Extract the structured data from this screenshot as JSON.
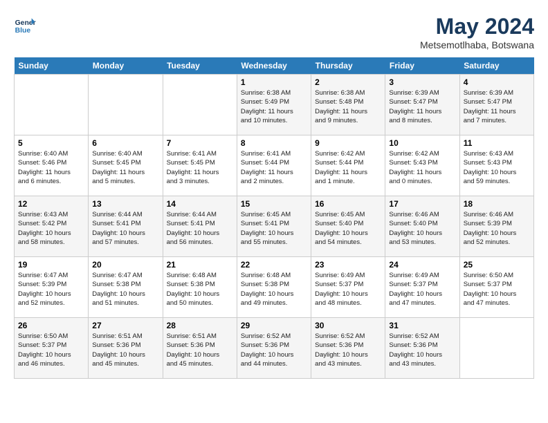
{
  "header": {
    "logo_line1": "General",
    "logo_line2": "Blue",
    "month": "May 2024",
    "location": "Metsemotlhaba, Botswana"
  },
  "days_of_week": [
    "Sunday",
    "Monday",
    "Tuesday",
    "Wednesday",
    "Thursday",
    "Friday",
    "Saturday"
  ],
  "weeks": [
    [
      {
        "num": "",
        "info": ""
      },
      {
        "num": "",
        "info": ""
      },
      {
        "num": "",
        "info": ""
      },
      {
        "num": "1",
        "info": "Sunrise: 6:38 AM\nSunset: 5:49 PM\nDaylight: 11 hours\nand 10 minutes."
      },
      {
        "num": "2",
        "info": "Sunrise: 6:38 AM\nSunset: 5:48 PM\nDaylight: 11 hours\nand 9 minutes."
      },
      {
        "num": "3",
        "info": "Sunrise: 6:39 AM\nSunset: 5:47 PM\nDaylight: 11 hours\nand 8 minutes."
      },
      {
        "num": "4",
        "info": "Sunrise: 6:39 AM\nSunset: 5:47 PM\nDaylight: 11 hours\nand 7 minutes."
      }
    ],
    [
      {
        "num": "5",
        "info": "Sunrise: 6:40 AM\nSunset: 5:46 PM\nDaylight: 11 hours\nand 6 minutes."
      },
      {
        "num": "6",
        "info": "Sunrise: 6:40 AM\nSunset: 5:45 PM\nDaylight: 11 hours\nand 5 minutes."
      },
      {
        "num": "7",
        "info": "Sunrise: 6:41 AM\nSunset: 5:45 PM\nDaylight: 11 hours\nand 3 minutes."
      },
      {
        "num": "8",
        "info": "Sunrise: 6:41 AM\nSunset: 5:44 PM\nDaylight: 11 hours\nand 2 minutes."
      },
      {
        "num": "9",
        "info": "Sunrise: 6:42 AM\nSunset: 5:44 PM\nDaylight: 11 hours\nand 1 minute."
      },
      {
        "num": "10",
        "info": "Sunrise: 6:42 AM\nSunset: 5:43 PM\nDaylight: 11 hours\nand 0 minutes."
      },
      {
        "num": "11",
        "info": "Sunrise: 6:43 AM\nSunset: 5:43 PM\nDaylight: 10 hours\nand 59 minutes."
      }
    ],
    [
      {
        "num": "12",
        "info": "Sunrise: 6:43 AM\nSunset: 5:42 PM\nDaylight: 10 hours\nand 58 minutes."
      },
      {
        "num": "13",
        "info": "Sunrise: 6:44 AM\nSunset: 5:41 PM\nDaylight: 10 hours\nand 57 minutes."
      },
      {
        "num": "14",
        "info": "Sunrise: 6:44 AM\nSunset: 5:41 PM\nDaylight: 10 hours\nand 56 minutes."
      },
      {
        "num": "15",
        "info": "Sunrise: 6:45 AM\nSunset: 5:41 PM\nDaylight: 10 hours\nand 55 minutes."
      },
      {
        "num": "16",
        "info": "Sunrise: 6:45 AM\nSunset: 5:40 PM\nDaylight: 10 hours\nand 54 minutes."
      },
      {
        "num": "17",
        "info": "Sunrise: 6:46 AM\nSunset: 5:40 PM\nDaylight: 10 hours\nand 53 minutes."
      },
      {
        "num": "18",
        "info": "Sunrise: 6:46 AM\nSunset: 5:39 PM\nDaylight: 10 hours\nand 52 minutes."
      }
    ],
    [
      {
        "num": "19",
        "info": "Sunrise: 6:47 AM\nSunset: 5:39 PM\nDaylight: 10 hours\nand 52 minutes."
      },
      {
        "num": "20",
        "info": "Sunrise: 6:47 AM\nSunset: 5:38 PM\nDaylight: 10 hours\nand 51 minutes."
      },
      {
        "num": "21",
        "info": "Sunrise: 6:48 AM\nSunset: 5:38 PM\nDaylight: 10 hours\nand 50 minutes."
      },
      {
        "num": "22",
        "info": "Sunrise: 6:48 AM\nSunset: 5:38 PM\nDaylight: 10 hours\nand 49 minutes."
      },
      {
        "num": "23",
        "info": "Sunrise: 6:49 AM\nSunset: 5:37 PM\nDaylight: 10 hours\nand 48 minutes."
      },
      {
        "num": "24",
        "info": "Sunrise: 6:49 AM\nSunset: 5:37 PM\nDaylight: 10 hours\nand 47 minutes."
      },
      {
        "num": "25",
        "info": "Sunrise: 6:50 AM\nSunset: 5:37 PM\nDaylight: 10 hours\nand 47 minutes."
      }
    ],
    [
      {
        "num": "26",
        "info": "Sunrise: 6:50 AM\nSunset: 5:37 PM\nDaylight: 10 hours\nand 46 minutes."
      },
      {
        "num": "27",
        "info": "Sunrise: 6:51 AM\nSunset: 5:36 PM\nDaylight: 10 hours\nand 45 minutes."
      },
      {
        "num": "28",
        "info": "Sunrise: 6:51 AM\nSunset: 5:36 PM\nDaylight: 10 hours\nand 45 minutes."
      },
      {
        "num": "29",
        "info": "Sunrise: 6:52 AM\nSunset: 5:36 PM\nDaylight: 10 hours\nand 44 minutes."
      },
      {
        "num": "30",
        "info": "Sunrise: 6:52 AM\nSunset: 5:36 PM\nDaylight: 10 hours\nand 43 minutes."
      },
      {
        "num": "31",
        "info": "Sunrise: 6:52 AM\nSunset: 5:36 PM\nDaylight: 10 hours\nand 43 minutes."
      },
      {
        "num": "",
        "info": ""
      }
    ]
  ]
}
